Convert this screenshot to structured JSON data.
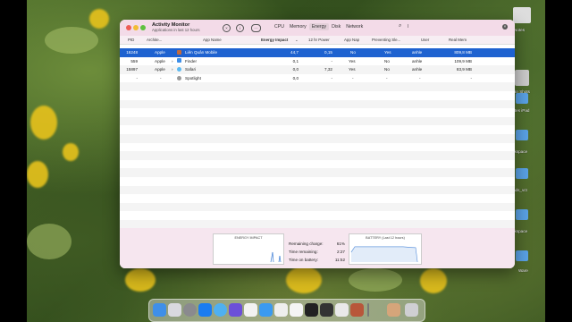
{
  "window": {
    "title": "Activity Monitor",
    "subtitle": "Applications in last 12 hours",
    "tabs": [
      "CPU",
      "Memory",
      "Energy",
      "Disk",
      "Network"
    ],
    "selected_tab": "Energy",
    "search_query": "l",
    "toolbar_icons": [
      "close-process-icon",
      "info-icon",
      "more-options-icon"
    ]
  },
  "table": {
    "columns": [
      "PID",
      "Archite...",
      "App Name",
      "Energy Impact",
      "12 hr Power",
      "App Nap",
      "Preventing Sle...",
      "User",
      "Real Mem"
    ],
    "rows": [
      {
        "pid": "16248",
        "arch": "Apple",
        "expand": "",
        "app": "Liên Quân Mobile",
        "energy": "44,7",
        "power": "0,15",
        "appnap": "No",
        "prevent": "Yes",
        "user": "anhle",
        "mem": "809,8 MB",
        "selected": true
      },
      {
        "pid": "559",
        "arch": "Apple",
        "expand": "›",
        "app": "Finder",
        "energy": "0,1",
        "power": "-",
        "appnap": "Yes",
        "prevent": "No",
        "user": "anhle",
        "mem": "109,9 MB",
        "selected": false
      },
      {
        "pid": "15897",
        "arch": "Apple",
        "expand": "›",
        "app": "Safari",
        "energy": "0,0",
        "power": "7,32",
        "appnap": "Yes",
        "prevent": "No",
        "user": "anhle",
        "mem": "83,9 MB",
        "selected": false
      },
      {
        "pid": "-",
        "arch": "-",
        "expand": "",
        "app": "Spotlight",
        "energy": "0,0",
        "power": "-",
        "appnap": "-",
        "prevent": "-",
        "user": "-",
        "mem": "-",
        "selected": false
      }
    ]
  },
  "footer": {
    "energy_impact_title": "ENERGY IMPACT",
    "battery_title": "BATTERY (Last 12 hours)",
    "stats": [
      {
        "label": "Remaining charge:",
        "value": "61%"
      },
      {
        "label": "Time remaining:",
        "value": "2:27"
      },
      {
        "label": "Time on battery:",
        "value": "11:52"
      }
    ]
  },
  "desktop_labels": [
    "Notes",
    "Màn Shots",
    "Notes iPad",
    "rkspace",
    "ads_vct",
    "rkspace",
    "Ware"
  ],
  "colors": {
    "selection": "#1e62d0",
    "titlebar": "#f3dbe8",
    "footer_bg": "#f6e6ef"
  }
}
